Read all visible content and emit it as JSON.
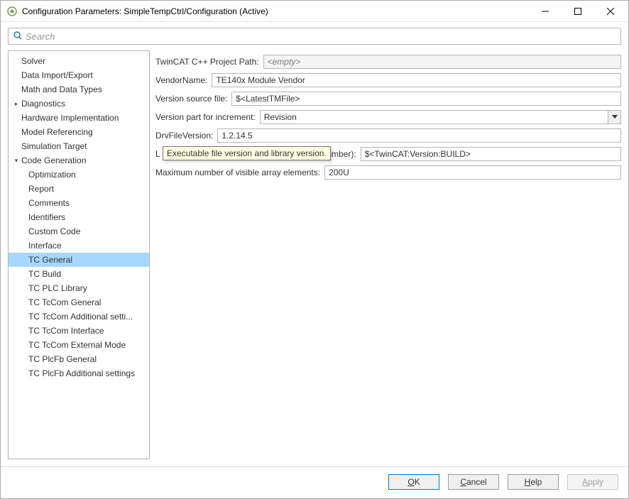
{
  "window": {
    "title": "Configuration Parameters: SimpleTempCtrl/Configuration (Active)"
  },
  "search": {
    "placeholder": "Search"
  },
  "sidebar": {
    "items": [
      {
        "label": "Solver",
        "depth": 0,
        "caret": "",
        "selected": false
      },
      {
        "label": "Data Import/Export",
        "depth": 0,
        "caret": "",
        "selected": false
      },
      {
        "label": "Math and Data Types",
        "depth": 0,
        "caret": "",
        "selected": false
      },
      {
        "label": "Diagnostics",
        "depth": 0,
        "caret": "▸",
        "selected": false
      },
      {
        "label": "Hardware Implementation",
        "depth": 0,
        "caret": "",
        "selected": false
      },
      {
        "label": "Model Referencing",
        "depth": 0,
        "caret": "",
        "selected": false
      },
      {
        "label": "Simulation Target",
        "depth": 0,
        "caret": "",
        "selected": false
      },
      {
        "label": "Code Generation",
        "depth": 0,
        "caret": "▾",
        "selected": false
      },
      {
        "label": "Optimization",
        "depth": 1,
        "caret": "",
        "selected": false
      },
      {
        "label": "Report",
        "depth": 1,
        "caret": "",
        "selected": false
      },
      {
        "label": "Comments",
        "depth": 1,
        "caret": "",
        "selected": false
      },
      {
        "label": "Identifiers",
        "depth": 1,
        "caret": "",
        "selected": false
      },
      {
        "label": "Custom Code",
        "depth": 1,
        "caret": "",
        "selected": false
      },
      {
        "label": "Interface",
        "depth": 1,
        "caret": "",
        "selected": false
      },
      {
        "label": "TC General",
        "depth": 1,
        "caret": "",
        "selected": true
      },
      {
        "label": "TC Build",
        "depth": 1,
        "caret": "",
        "selected": false
      },
      {
        "label": "TC PLC Library",
        "depth": 1,
        "caret": "",
        "selected": false
      },
      {
        "label": "TC TcCom General",
        "depth": 1,
        "caret": "",
        "selected": false
      },
      {
        "label": "TC TcCom Additional setti...",
        "depth": 1,
        "caret": "",
        "selected": false
      },
      {
        "label": "TC TcCom Interface",
        "depth": 1,
        "caret": "",
        "selected": false
      },
      {
        "label": "TC TcCom External Mode",
        "depth": 1,
        "caret": "",
        "selected": false
      },
      {
        "label": "TC PlcFb General",
        "depth": 1,
        "caret": "",
        "selected": false
      },
      {
        "label": "TC PlcFb Additional settings",
        "depth": 1,
        "caret": "",
        "selected": false
      }
    ]
  },
  "form": {
    "project_path": {
      "label": "TwinCAT C++ Project Path:",
      "value": "<empty>"
    },
    "vendor_name": {
      "label": "VendorName:",
      "value": "TE140x Module Vendor"
    },
    "version_source": {
      "label": "Version source file:",
      "value": "$<LatestTMFile>"
    },
    "version_part": {
      "label": "Version part for increment:",
      "value": "Revision"
    },
    "drv_file_version": {
      "label": "DrvFileVersion:",
      "value": "1.2.14.5"
    },
    "load_repl": {
      "label_prefix": "L",
      "label_suffix": " number):",
      "value": "$<TwinCAT:Version:BUILD>"
    },
    "max_visible": {
      "label": "Maximum number of visible array elements:",
      "value": "200U"
    },
    "tooltip": "Executable file version and library version."
  },
  "footer": {
    "ok": "OK",
    "cancel": "Cancel",
    "help": "Help",
    "apply": "Apply"
  }
}
